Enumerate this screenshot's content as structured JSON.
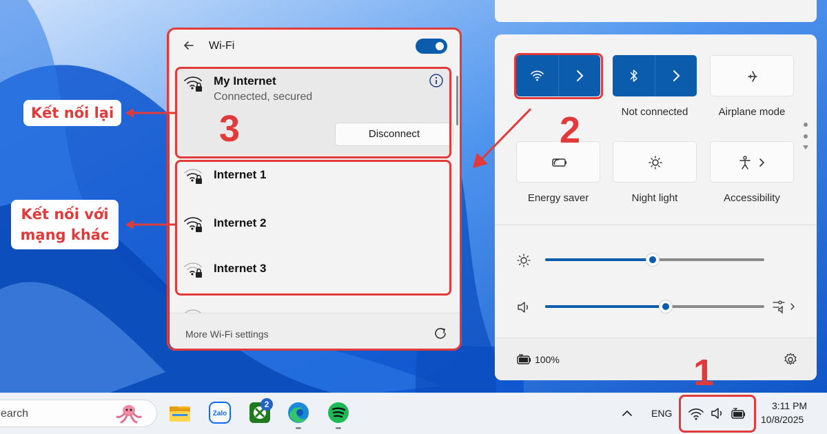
{
  "wifi_panel": {
    "title": "Wi-Fi",
    "toggle_state": "on",
    "connected": {
      "name": "My Internet",
      "status": "Connected, secured",
      "disconnect_label": "Disconnect"
    },
    "networks": [
      {
        "name": "Internet 1"
      },
      {
        "name": "Internet 2"
      },
      {
        "name": "Internet 3"
      }
    ],
    "more_settings": "More Wi-Fi settings"
  },
  "quick_settings": {
    "tiles": [
      {
        "label": "",
        "icon": "wifi-icon",
        "active": true
      },
      {
        "label": "Not connected",
        "icon": "bluetooth-icon",
        "active": true
      },
      {
        "label": "Airplane mode",
        "icon": "airplane-icon",
        "active": false
      },
      {
        "label": "Energy saver",
        "icon": "energy-saver-icon",
        "active": false
      },
      {
        "label": "Night light",
        "icon": "night-light-icon",
        "active": false
      },
      {
        "label": "Accessibility",
        "icon": "accessibility-icon",
        "active": false
      }
    ],
    "brightness": 0.49,
    "volume": 0.55,
    "battery_percent": "100%"
  },
  "taskbar": {
    "search_text": "earch",
    "language": "ENG",
    "time": "3:11 PM",
    "date": "10/8/2025",
    "xbox_badge": "2",
    "zalo_label": "Zalo"
  },
  "annotations": {
    "step1": "1",
    "step2": "2",
    "step3": "3",
    "callout_reconnect": "Kết nối lại",
    "callout_other": "Kết nối với mạng khác"
  },
  "colors": {
    "accent": "#0b5cad",
    "annotation_red": "#e23a3a",
    "wallpaper": "#1b6fe0"
  }
}
